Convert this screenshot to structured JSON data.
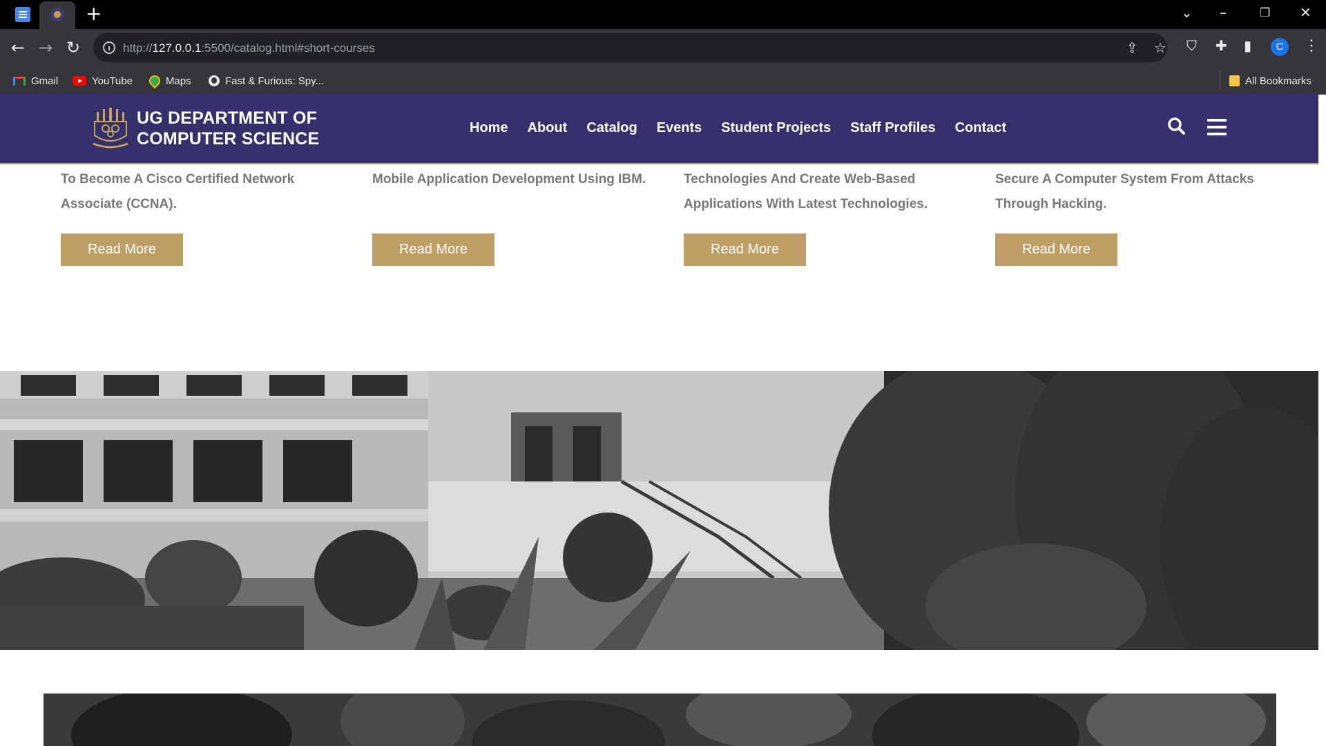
{
  "browser": {
    "url_prefix": "http://",
    "url_host": "127.0.0.1",
    "url_rest": ":5500/catalog.html#short-courses",
    "profile_initial": "C",
    "bookmarks": [
      {
        "label": "Gmail",
        "icon": "gmail-icon"
      },
      {
        "label": "YouTube",
        "icon": "youtube-icon"
      },
      {
        "label": "Maps",
        "icon": "maps-icon"
      },
      {
        "label": "Fast & Furious: Spy...",
        "icon": "globe-icon"
      }
    ],
    "all_bookmarks_label": "All Bookmarks"
  },
  "site": {
    "title_line1": "UG DEPARTMENT OF",
    "title_line2": "COMPUTER SCIENCE",
    "nav": [
      "Home",
      "About",
      "Catalog",
      "Events",
      "Student Projects",
      "Staff Profiles",
      "Contact"
    ]
  },
  "courses": [
    {
      "text": "To Become A Cisco Certified Network Associate (CCNA).",
      "button": "Read More"
    },
    {
      "text": "Mobile Application Development Using IBM.",
      "button": "Read More"
    },
    {
      "text": "Technologies And Create Web-Based Applications With Latest Technologies.",
      "button": "Read More"
    },
    {
      "text": "Secure A Computer System From Attacks Through Hacking.",
      "button": "Read More"
    }
  ],
  "colors": {
    "header_bg": "#34306b",
    "accent_gold": "#c09f67",
    "body_text": "#777777"
  }
}
